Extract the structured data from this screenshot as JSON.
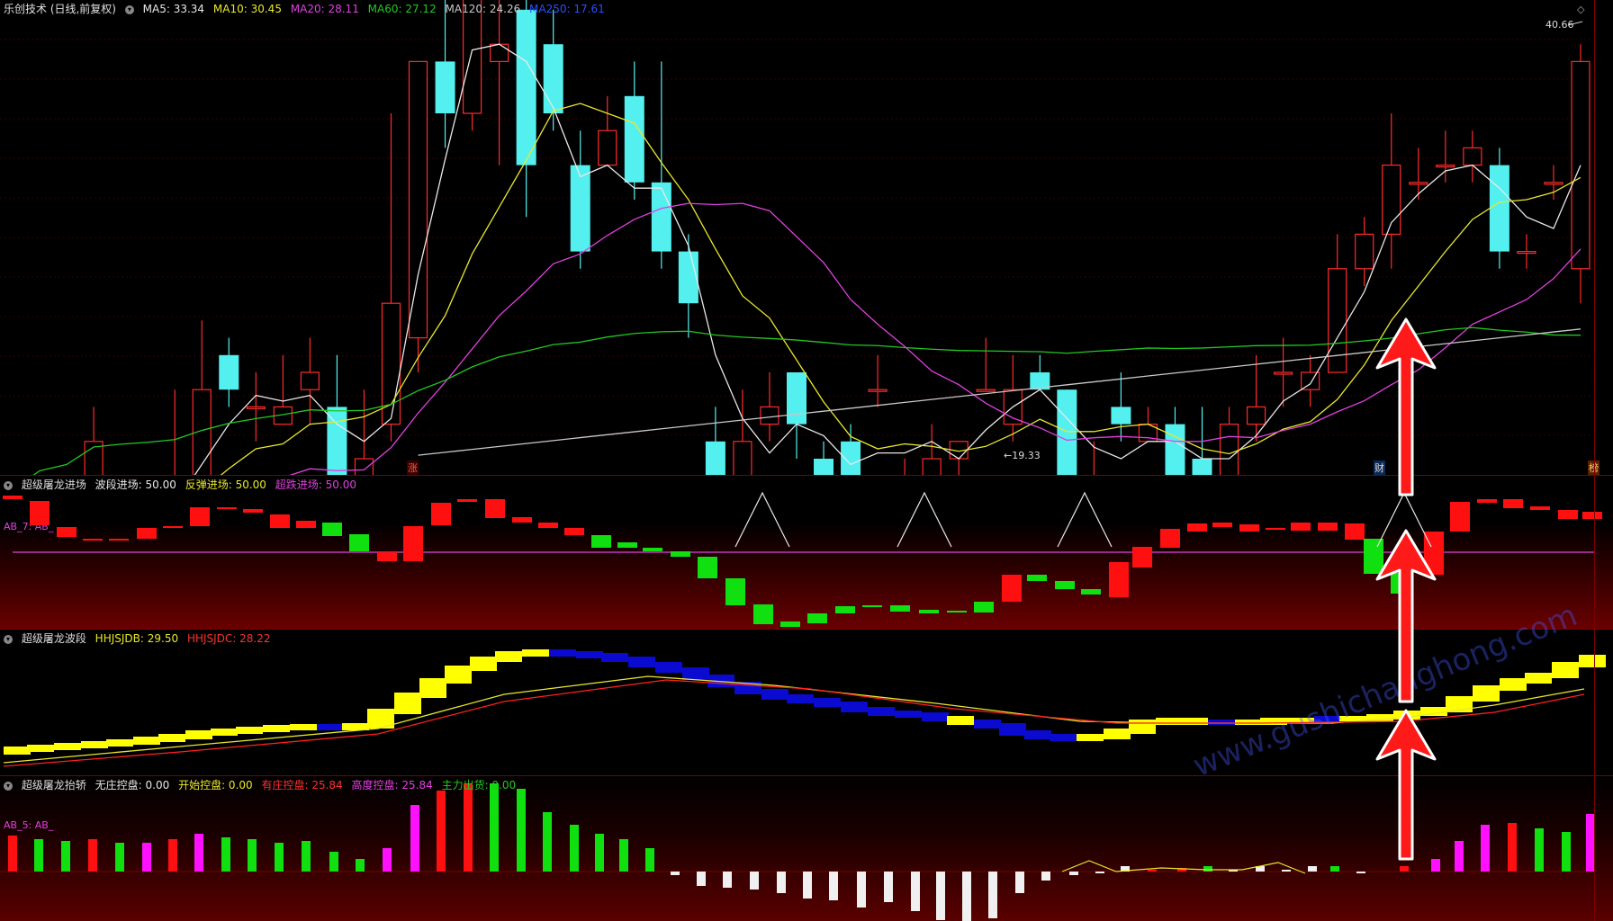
{
  "colors": {
    "bg": "#000000",
    "up": "#ff2a2a",
    "down": "#54f0f0",
    "ma5": "#e8e8e8",
    "ma10": "#e8e82c",
    "ma20": "#e040e0",
    "ma60": "#22c822",
    "ma120": "#c8c8c8",
    "ma250": "#2a50ff",
    "arrow": "#ff1a1a"
  },
  "main": {
    "title": "乐创技术 (日线,前复权)",
    "ma5": "MA5: 33.34",
    "ma10": "MA10: 30.45",
    "ma20": "MA20: 28.11",
    "ma60": "MA60: 27.12",
    "ma120": "MA120: 24.26",
    "ma250": "MA250: 17.61",
    "high_label": "40.66",
    "low_label": "←19.33",
    "mark1": "涨",
    "mark2": "财",
    "mark3": "榜",
    "candles": [
      [
        12.0,
        7.0,
        8.0,
        13.0,
        4.0
      ],
      [
        42.0,
        16.0,
        12.0,
        16.0,
        10.0
      ],
      [
        68.0,
        10.0,
        12.0,
        14.0,
        8.0
      ],
      [
        103.0,
        16.0,
        18.0,
        20.0,
        15.0
      ],
      [
        129.0,
        12.0,
        14.0,
        16.0,
        11.0
      ],
      [
        162.0,
        10.0,
        14.0,
        16.0,
        9.0
      ],
      [
        192.0,
        15.0,
        15.0,
        21.0,
        13.0
      ],
      [
        219.0,
        13.0,
        21.0,
        25.0,
        11.0
      ],
      [
        252.0,
        23.0,
        21.0,
        24.0,
        20.0
      ],
      [
        280.0,
        20.0,
        20.0,
        22.0,
        18.0
      ],
      [
        308.0,
        19.0,
        20.0,
        23.0,
        19.0
      ],
      [
        339.0,
        21.0,
        22.0,
        24.0,
        19.0
      ],
      [
        370.0,
        20.0,
        15.0,
        23.0,
        15.0
      ],
      [
        400.0,
        16.0,
        17.0,
        21.0,
        14.0
      ],
      [
        429.0,
        19.0,
        26.0,
        37.0,
        18.0
      ],
      [
        459.0,
        24.0,
        40.0,
        40.0,
        22.0
      ],
      [
        490.0,
        40.0,
        37.0,
        44.0,
        35.0
      ],
      [
        519.0,
        37.0,
        45.0,
        53.0,
        36.0
      ],
      [
        550.0,
        40.0,
        41.0,
        47.0,
        34.0
      ],
      [
        580.0,
        43.0,
        34.0,
        44.0,
        31.0
      ],
      [
        609.0,
        41.0,
        37.0,
        43.0,
        36.0
      ],
      [
        637.0,
        34.0,
        29.0,
        36.0,
        28.0
      ],
      [
        670.0,
        34.0,
        36.0,
        38.0,
        34.0
      ],
      [
        701.0,
        38.0,
        33.0,
        40.0,
        32.0
      ],
      [
        730.0,
        33.0,
        29.0,
        40.0,
        28.0
      ],
      [
        756.0,
        29.0,
        26.0,
        30.0,
        24.0
      ],
      [
        790.0,
        18.0,
        14.0,
        20.0,
        12.0
      ],
      [
        820.0,
        16.0,
        18.0,
        21.0,
        15.0
      ],
      [
        848.0,
        19.0,
        20.0,
        22.0,
        18.0
      ],
      [
        878.0,
        22.0,
        19.0,
        22.0,
        17.0
      ],
      [
        908.0,
        17.0,
        16.0,
        18.0,
        15.0
      ],
      [
        938.0,
        18.0,
        15.0,
        19.0,
        14.0
      ],
      [
        961.0,
        21.0,
        21.0,
        23.0,
        20.0
      ],
      [
        1012.0,
        16.0,
        16.0,
        17.0,
        13.0
      ],
      [
        1050.0,
        15.0,
        17.0,
        19.0,
        14.0
      ],
      [
        1082.0,
        17.0,
        18.0,
        18.0,
        16.0
      ],
      [
        1121.0,
        21.0,
        21.0,
        24.0,
        21.0
      ],
      [
        1146.0,
        19.0,
        21.0,
        23.0,
        18.0
      ],
      [
        1178.0,
        22.0,
        21.0,
        23.0,
        21.0
      ],
      [
        1203.0,
        21.0,
        16.0,
        21.0,
        15.0
      ],
      [
        1226.0,
        15.0,
        16.0,
        18.0,
        14.0
      ],
      [
        1255.0,
        20.0,
        19.0,
        22.0,
        18.0
      ],
      [
        1287.0,
        18.0,
        19.0,
        20.0,
        18.0
      ],
      [
        1318.0,
        19.0,
        16.0,
        20.0,
        15.0
      ],
      [
        1349.0,
        17.0,
        16.0,
        20.0,
        16.0
      ],
      [
        1380.0,
        16.0,
        19.0,
        20.0,
        15.0
      ],
      [
        1410.0,
        19.0,
        20.0,
        23.0,
        18.0
      ],
      [
        1439.0,
        22.0,
        22.0,
        24.0,
        20.0
      ],
      [
        1463.0,
        21.0,
        22.0,
        23.0,
        20.0
      ],
      [
        1493.0,
        22.0,
        28.0,
        30.0,
        22.0
      ],
      [
        1521.0,
        28.0,
        30.0,
        31.0,
        27.0
      ],
      [
        1547.0,
        30.0,
        34.0,
        37.0,
        28.0
      ],
      [
        1580.0,
        33.0,
        33.0,
        35.0,
        32.0
      ],
      [
        1608.0,
        34.0,
        34.0,
        36.0,
        33.0
      ],
      [
        1643.0,
        34.0,
        35.0,
        36.0,
        33.0
      ],
      [
        1676.0,
        34.0,
        29.0,
        35.0,
        28.0
      ],
      [
        1707.0,
        29.0,
        29.0,
        30.0,
        28.0
      ],
      [
        1734.0,
        33.0,
        33.0,
        34.0,
        32.0
      ],
      [
        1765.0,
        28.0,
        40.0,
        41.0,
        26.0
      ]
    ]
  },
  "p2": {
    "title": "超级屠龙进场",
    "v1": "波段进场: 50.00",
    "v2": "反弹进场: 50.00",
    "v3": "超跌进场: 50.00",
    "left_label": "AB_7: AB_"
  },
  "p3": {
    "title": "超级屠龙波段",
    "v1": "HHJSJDB: 29.50",
    "v2": "HHJSJDC: 28.22"
  },
  "p4": {
    "title": "超级屠龙抬轿",
    "v1": "无庄控盘: 0.00",
    "v2": "开始控盘: 0.00",
    "v3": "有庄控盘: 25.84",
    "v4": "高度控盘: 25.84",
    "v5": "主力出货: 0.00",
    "left_label": "AB_5: AB_",
    "watermark": "www.gushichanghong.com"
  }
}
